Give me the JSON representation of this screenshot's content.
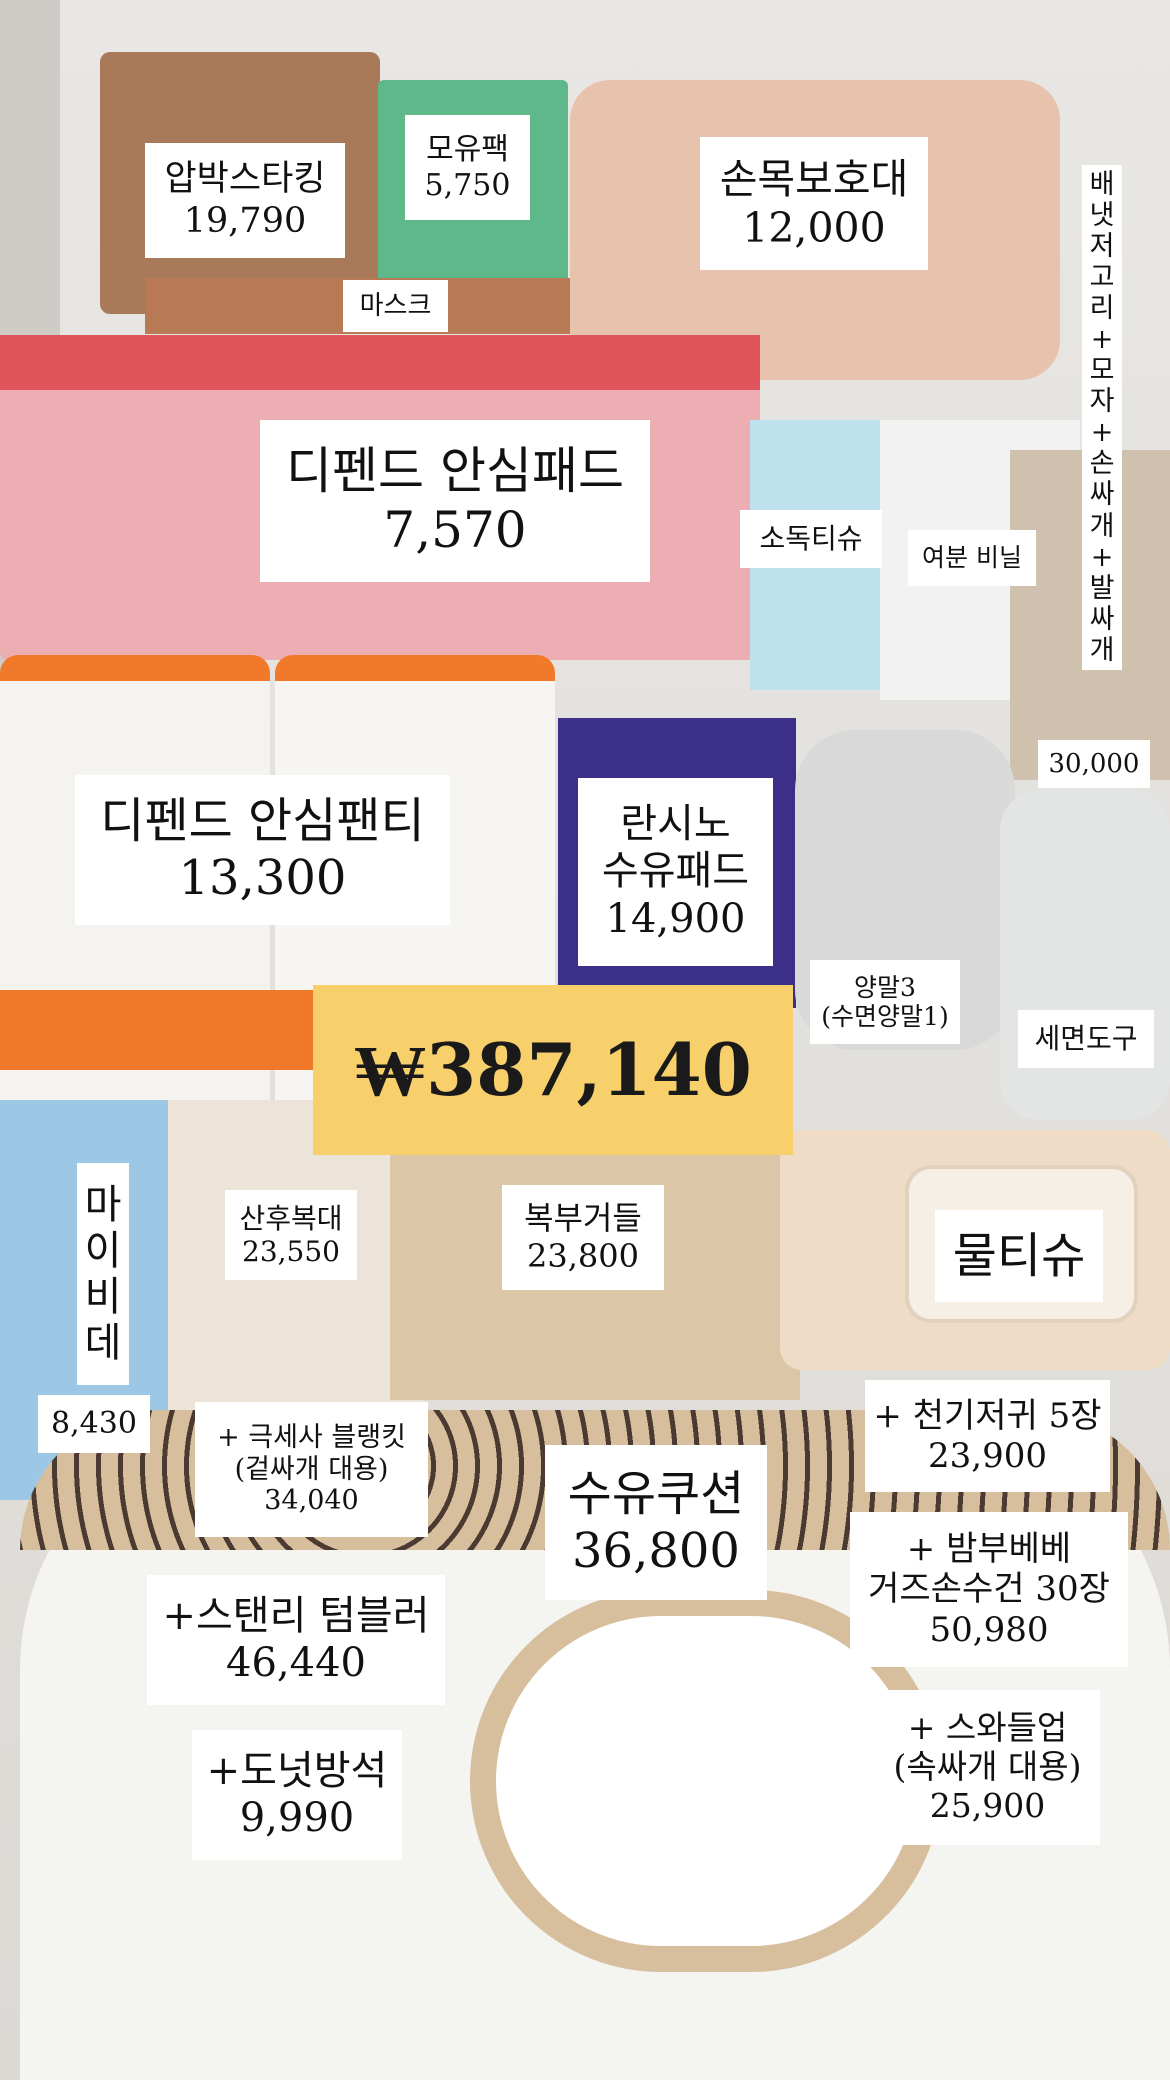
{
  "total": "₩387,140",
  "labels": {
    "compression_stockings": {
      "name": "압박스타킹",
      "price": "19,790"
    },
    "breast_milk_pack": {
      "name": "모유팩",
      "price": "5,750"
    },
    "wrist_guard": {
      "name": "손목보호대",
      "price": "12,000"
    },
    "mask": {
      "name": "마스크"
    },
    "newborn_set": {
      "name": [
        "배",
        "냇",
        "저",
        "고",
        "리",
        "+",
        "모",
        "자",
        "+",
        "손",
        "싸",
        "개",
        "+",
        "발",
        "싸",
        "개"
      ],
      "price": "30,000"
    },
    "depend_pad": {
      "name": "디펜드 안심패드",
      "price": "7,570"
    },
    "sanitizer_tissue": {
      "name": "소독티슈"
    },
    "spare_vinyl": {
      "name": "여분 비닐"
    },
    "depend_panty": {
      "name": "디펜드 안심팬티",
      "price": "13,300"
    },
    "lansinoh_pad": {
      "name_line1": "란시노",
      "name_line2": "수유패드",
      "price": "14,900"
    },
    "socks": {
      "name_line1": "양말3",
      "name_line2": "(수면양말1)"
    },
    "toiletries": {
      "name": "세면도구"
    },
    "my_bidet": {
      "name": [
        "마",
        "이",
        "비",
        "데"
      ],
      "price": "8,430"
    },
    "postpartum_belt": {
      "name": "산후복대",
      "price": "23,550"
    },
    "abdominal_girdle": {
      "name": "복부거들",
      "price": "23,800"
    },
    "wet_wipes": {
      "name": "물티슈"
    },
    "fleece_blanket": {
      "name_line1": "+ 극세사 블랭킷",
      "name_line2": "(겉싸개 대용)",
      "price": "34,040"
    },
    "nursing_cushion": {
      "name": "수유쿠션",
      "price": "36,800"
    },
    "cloth_diaper": {
      "name": "+ 천기저귀 5장",
      "price": "23,900"
    },
    "bambou_towel": {
      "name_line1": "+ 밤부베베",
      "name_line2": "거즈손수건 30장",
      "price": "50,980"
    },
    "stanley_tumbler": {
      "name": "+스탠리 텀블러",
      "price": "46,440"
    },
    "swaddle_up": {
      "name_line1": "+ 스와들업",
      "name_line2": "(속싸개 대용)",
      "price": "25,900"
    },
    "donut_cushion": {
      "name": "+도넛방석",
      "price": "9,990"
    }
  }
}
